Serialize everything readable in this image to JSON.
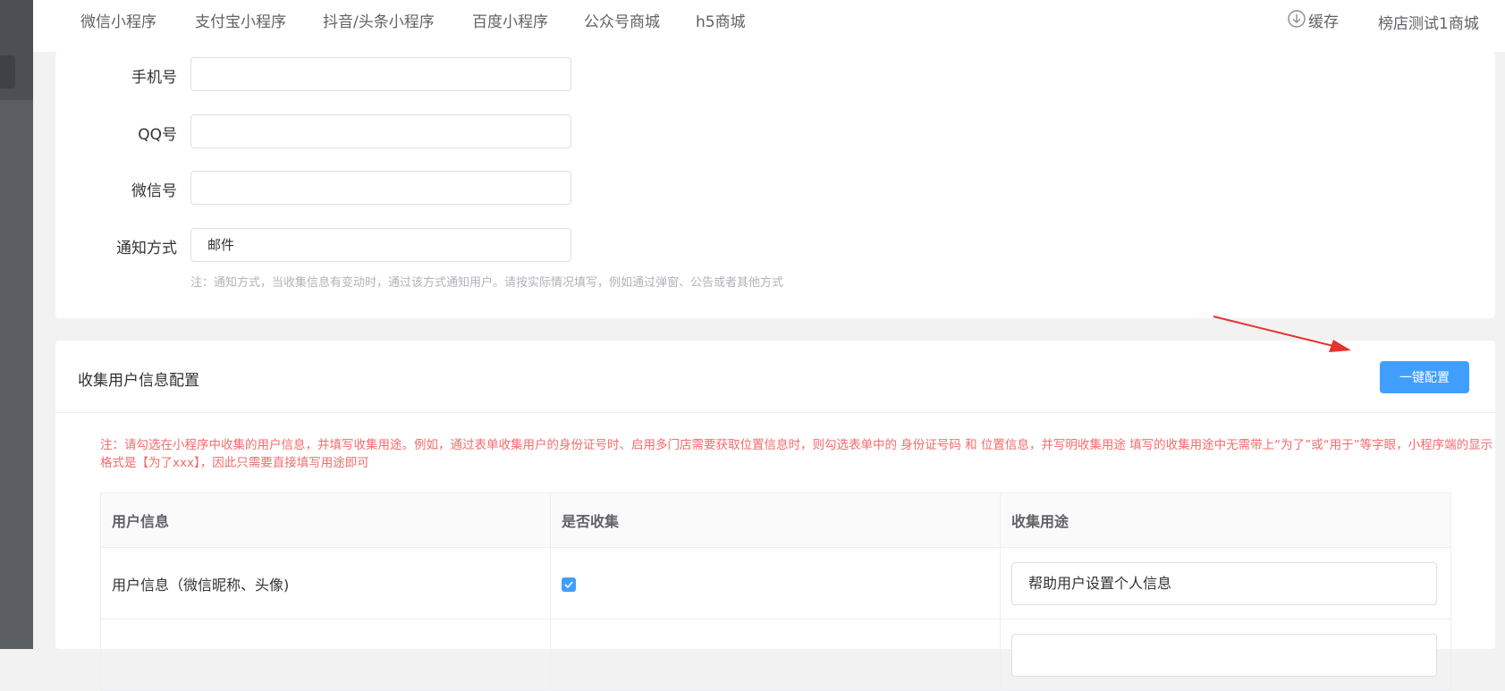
{
  "topnav": {
    "tabs": [
      "微信小程序",
      "支付宝小程序",
      "抖音/头条小程序",
      "百度小程序",
      "公众号商城",
      "h5商城"
    ],
    "cache_label": "缓存",
    "store_name": "榜店测试1商城"
  },
  "contact_form": {
    "phone_label": "手机号",
    "phone_value": "",
    "qq_label": "QQ号",
    "qq_value": "",
    "wechat_label": "微信号",
    "wechat_value": "",
    "notify_label": "通知方式",
    "notify_value": "邮件",
    "notify_hint": "注：通知方式，当收集信息有变动时，通过该方式通知用户。请按实际情况填写，例如通过弹窗、公告或者其他方式"
  },
  "collect_config": {
    "title": "收集用户信息配置",
    "one_click_button": "一键配置",
    "note": "注：请勾选在小程序中收集的用户信息，并填写收集用途。例如，通过表单收集用户的身份证号时、启用多门店需要获取位置信息时，则勾选表单中的 身份证号码 和 位置信息，并写明收集用途 填写的收集用途中无需带上“为了”或“用于”等字眼，小程序端的显示格式是【为了xxx】，因此只需要直接填写用途即可",
    "table": {
      "headers": [
        "用户信息",
        "是否收集",
        "收集用途"
      ],
      "rows": [
        {
          "info": "用户信息（微信昵称、头像)",
          "collected": true,
          "purpose": "帮助用户设置个人信息"
        }
      ]
    }
  },
  "colors": {
    "primary": "#409eff",
    "danger": "#f56c6c",
    "arrow": "#e8312f"
  }
}
